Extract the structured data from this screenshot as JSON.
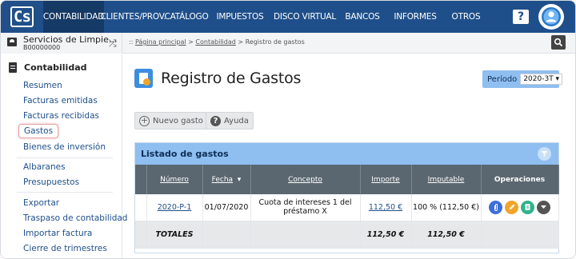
{
  "app": {
    "logo_text": "Cs",
    "nav": [
      "CONTABILIDAD",
      "CLIENTES/PROV.",
      "CATÁLOGO",
      "IMPUESTOS",
      "DISCO VIRTUAL",
      "BANCOS",
      "INFORMES",
      "OTROS"
    ],
    "active_nav": "CONTABILIDAD",
    "help_label": "?"
  },
  "company": {
    "name": "Servicios de Limpie...",
    "code": "B00000000"
  },
  "breadcrumb": {
    "prefix": ":: ",
    "home": "Página principal",
    "sep1": " > ",
    "section": "Contabilidad",
    "sep2": " > ",
    "current": "Registro de gastos"
  },
  "sidebar": {
    "header": "Contabilidad",
    "links": [
      "Resumen",
      "Facturas emitidas",
      "Facturas recibidas",
      "Gastos",
      "Bienes de inversión",
      "Albaranes",
      "Presupuestos",
      "Exportar",
      "Traspaso de contabilidad",
      "Importar factura",
      "Cierre de trimestres"
    ],
    "selected": "Gastos"
  },
  "page": {
    "title": "Registro de Gastos",
    "period_label": "Período",
    "period_value": "2020-3T ▾"
  },
  "toolbar": {
    "new_label": "Nuevo gasto",
    "help_label": "Ayuda"
  },
  "listing": {
    "title": "Listado de gastos",
    "columns": [
      "Número",
      "Fecha",
      "Concepto",
      "Importe",
      "Imputable",
      "Operaciones"
    ],
    "sort_marker": "  ▾",
    "rows": [
      {
        "numero": "2020-P-1",
        "fecha": "01/07/2020",
        "concepto": "Cuota de intereses 1 del préstamo X",
        "importe": "112,50 €",
        "imputable": "100 %  (112,50 €)"
      }
    ],
    "totals": {
      "label": "TOTALES",
      "importe": "112,50 €",
      "imputable": "112,50 €"
    }
  },
  "icons": {
    "user": "user-avatar-icon",
    "search": "search-icon",
    "swap": "swap-icon",
    "new": "plus-circle-icon",
    "help": "question-circle-icon",
    "filter": "filter-icon",
    "attach": "attachment-icon",
    "edit": "pencil-icon",
    "copy": "copy-icon",
    "more": "chevron-down-icon"
  },
  "colors": {
    "nav_bg": "#1f4f8a",
    "panel_head": "#8fbef0",
    "table_head": "#5b6770",
    "link": "#1f4f8a"
  }
}
